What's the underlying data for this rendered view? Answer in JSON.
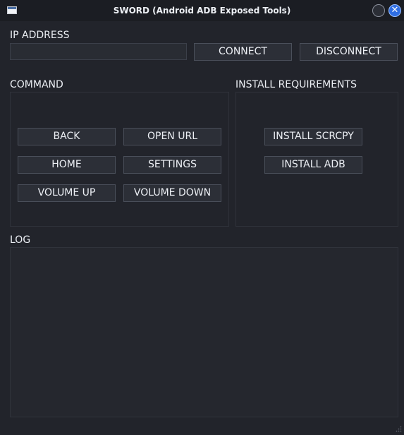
{
  "window": {
    "title": "SWORD (Android ADB Exposed Tools)",
    "close_glyph": "✕"
  },
  "ip": {
    "label": "IP ADDRESS",
    "value": "",
    "connect_label": "CONNECT",
    "disconnect_label": "DISCONNECT"
  },
  "command": {
    "label": "COMMAND",
    "back_label": "BACK",
    "open_url_label": "OPEN URL",
    "home_label": "HOME",
    "settings_label": "SETTINGS",
    "volume_up_label": "VOLUME UP",
    "volume_down_label": "VOLUME DOWN"
  },
  "install": {
    "label": "INSTALL REQUIREMENTS",
    "scrcpy_label": "INSTALL SCRCPY",
    "adb_label": "INSTALL ADB"
  },
  "log": {
    "label": "LOG",
    "content": ""
  },
  "colors": {
    "background": "#22242b",
    "titlebar": "#1b1d23",
    "button": "#2c2f37",
    "button_border": "#4a4f5a",
    "close_button": "#2f6ee3",
    "text": "#eceff4"
  },
  "icons": {
    "app": "window-icon",
    "minimize": "minimize-circle-icon",
    "close": "close-icon",
    "resize": "resize-grip-icon"
  }
}
